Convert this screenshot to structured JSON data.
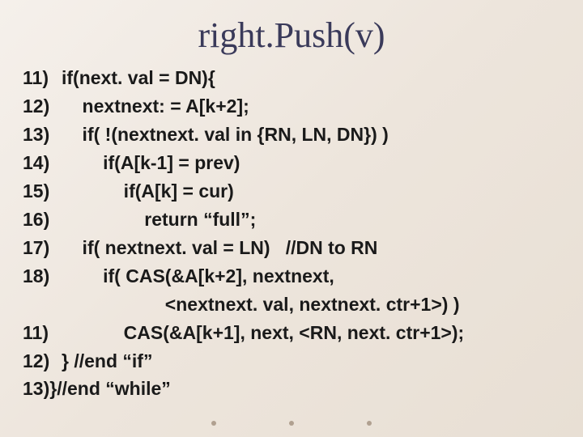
{
  "title": "right.Push(v)",
  "lines": [
    {
      "num": "11)",
      "indent": 0,
      "text": "if(next. val = DN){"
    },
    {
      "num": "12)",
      "indent": 1,
      "text": "nextnext: = A[k+2];"
    },
    {
      "num": "13)",
      "indent": 1,
      "text": "if( !(nextnext. val in {RN, LN, DN}) )"
    },
    {
      "num": "14)",
      "indent": 2,
      "text": "if(A[k-1] = prev)"
    },
    {
      "num": "15)",
      "indent": 3,
      "text": "if(A[k] = cur)"
    },
    {
      "num": "16)",
      "indent": 4,
      "text": "return “full”;"
    },
    {
      "num": "17)",
      "indent": 1,
      "text": "if( nextnext. val = LN)   //DN to RN"
    },
    {
      "num": "18)",
      "indent": 2,
      "text": "if( CAS(&A[k+2], nextnext,"
    },
    {
      "num": "",
      "indent": 5,
      "text": "<nextnext. val, nextnext. ctr+1>) )"
    },
    {
      "num": "11)",
      "indent": 3,
      "text": "CAS(&A[k+1], next, <RN, next. ctr+1>);"
    },
    {
      "num": "12)",
      "indent": 0,
      "text": "} //end “if”"
    },
    {
      "num": "13)",
      "indent": -1,
      "text": "}//end “while”"
    }
  ]
}
